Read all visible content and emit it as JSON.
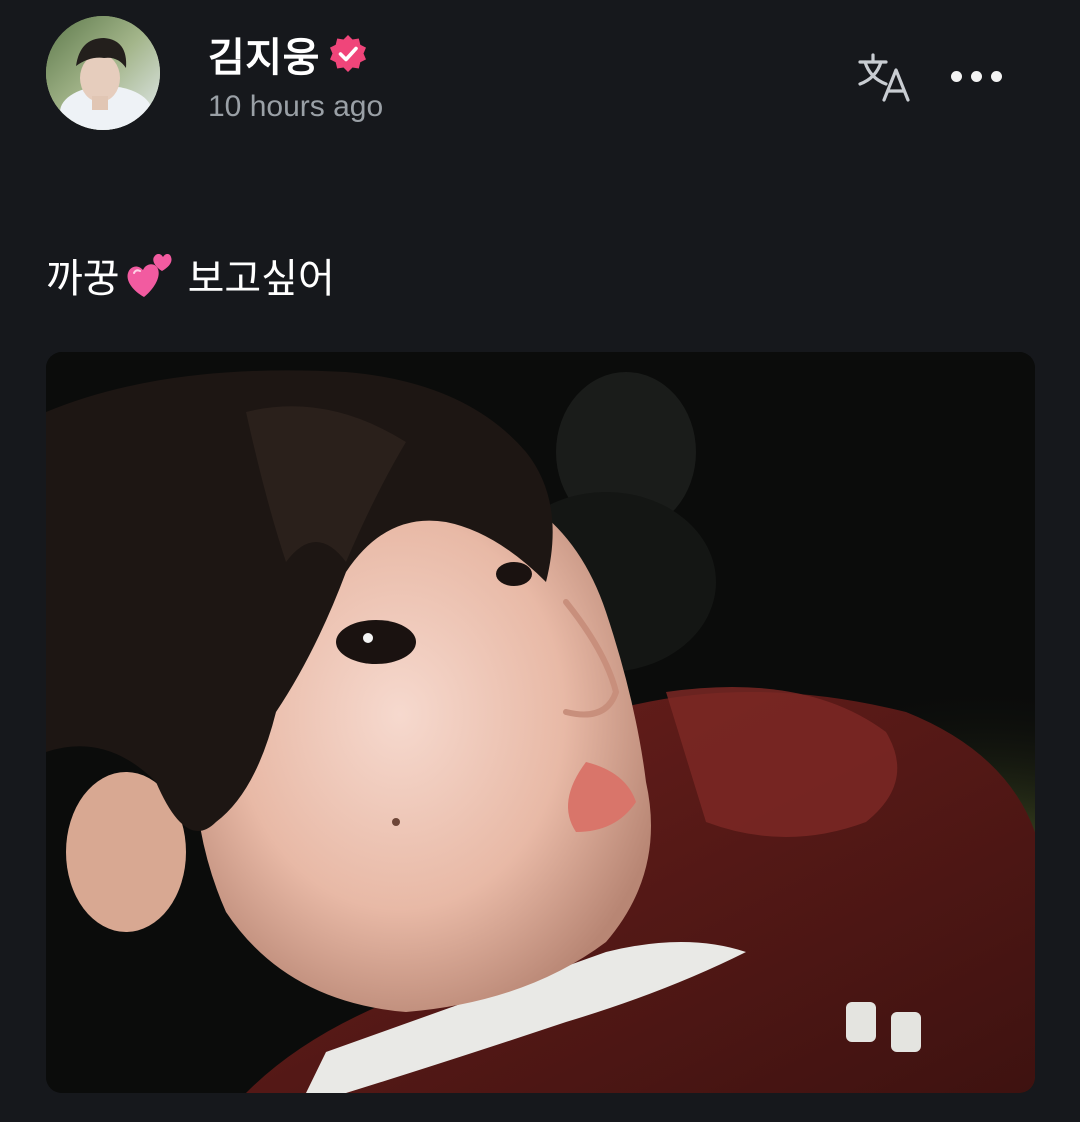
{
  "author": {
    "name": "김지웅",
    "verified": true,
    "timestamp": "10 hours ago",
    "avatar": "avatar-photo"
  },
  "actions": {
    "translate_icon": "translate-icon",
    "more_icon": "more-horizontal-icon"
  },
  "post": {
    "text_before": "까꿍",
    "emoji": "two-hearts-emoji",
    "text_after": "보고싶어",
    "image": "selfie-photo"
  },
  "colors": {
    "background": "#16181c",
    "verified_badge": "#f0457a",
    "secondary_text": "#9aa0a6",
    "heart_pink": "#f25ba0"
  }
}
